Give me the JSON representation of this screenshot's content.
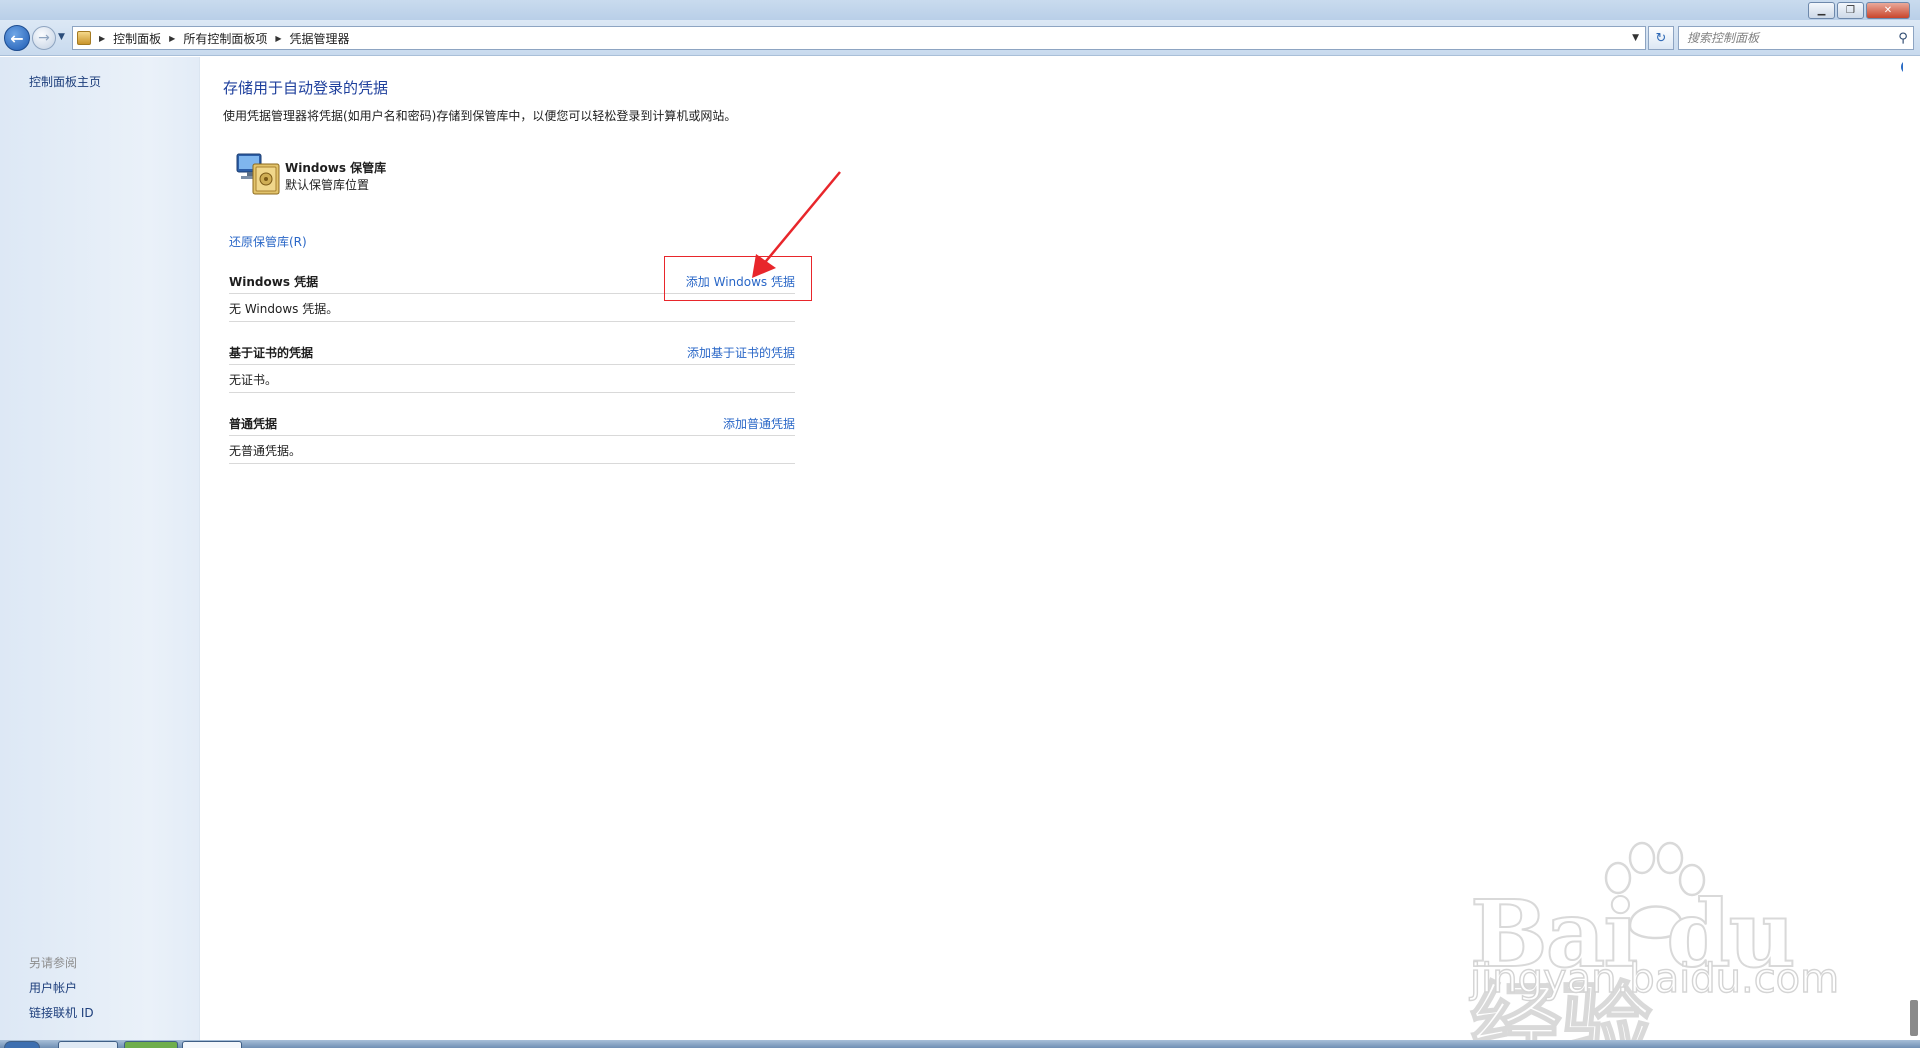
{
  "window": {
    "minimize_icon": "minimize-icon",
    "restore_icon": "restore-icon",
    "close_icon": "close-icon"
  },
  "address_bar": {
    "breadcrumbs": [
      "控制面板",
      "所有控制面板项",
      "凭据管理器"
    ],
    "search_placeholder": "搜索控制面板"
  },
  "sidebar": {
    "home_link": "控制面板主页",
    "see_also_title": "另请参阅",
    "see_also_links": [
      "用户帐户",
      "链接联机 ID"
    ]
  },
  "main": {
    "title": "存储用于自动登录的凭据",
    "description": "使用凭据管理器将凭据(如用户名和密码)存储到保管库中，以便您可以轻松登录到计算机或网站。",
    "vault": {
      "name": "Windows 保管库",
      "subtitle": "默认保管库位置"
    },
    "restore_link": "还原保管库(R)",
    "sections": [
      {
        "heading": "Windows 凭据",
        "add_link": "添加 Windows 凭据",
        "empty_text": "无 Windows 凭据。"
      },
      {
        "heading": "基于证书的凭据",
        "add_link": "添加基于证书的凭据",
        "empty_text": "无证书。"
      },
      {
        "heading": "普通凭据",
        "add_link": "添加普通凭据",
        "empty_text": "无普通凭据。"
      }
    ]
  },
  "annotation": {
    "color": "#e8262b"
  },
  "watermark": {
    "logo_text": "Bai du 经验",
    "url_text": "jingyan.baidu.com"
  },
  "colors": {
    "link": "#2a67c7",
    "title": "#1e3f9c",
    "sidebar_bg": "#e6eef8"
  }
}
